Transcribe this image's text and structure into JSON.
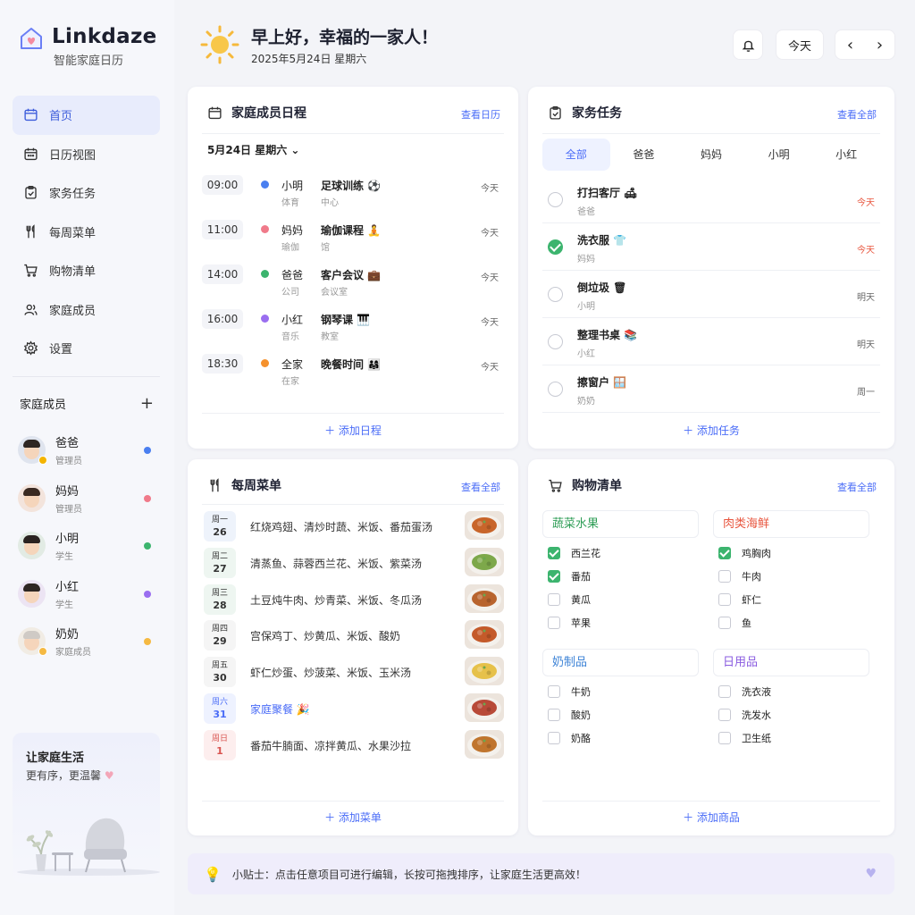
{
  "app": {
    "name": "Linkdaze",
    "subtitle": "智能家庭日历"
  },
  "nav": [
    {
      "label": "首页",
      "icon": "calendar-icon",
      "active": true
    },
    {
      "label": "日历视图",
      "icon": "calendar-grid-icon"
    },
    {
      "label": "家务任务",
      "icon": "clipboard-check-icon"
    },
    {
      "label": "每周菜单",
      "icon": "utensils-icon"
    },
    {
      "label": "购物清单",
      "icon": "cart-icon"
    },
    {
      "label": "家庭成员",
      "icon": "users-icon"
    },
    {
      "label": "设置",
      "icon": "gear-icon"
    }
  ],
  "family": {
    "title": "家庭成员",
    "add": "+",
    "members": [
      {
        "name": "爸爸",
        "role": "管理员",
        "color": "#4a7ff0"
      },
      {
        "name": "妈妈",
        "role": "管理员",
        "color": "#f07a8a"
      },
      {
        "name": "小明",
        "role": "学生",
        "color": "#3cb46e"
      },
      {
        "name": "小红",
        "role": "学生",
        "color": "#9a6ef0"
      },
      {
        "name": "奶奶",
        "role": "家庭成员",
        "color": "#f5b942"
      }
    ]
  },
  "promo": {
    "title": "让家庭生活",
    "subtitle": "更有序，更温馨",
    "heart": "♥"
  },
  "header": {
    "greeting": "早上好，幸福的一家人！",
    "date": "2025年5月24日  星期六",
    "today_button": "今天",
    "prev": "‹",
    "next": "›"
  },
  "schedule": {
    "title": "家庭成员日程",
    "link": "查看日历",
    "date_label": "5月24日  星期六 ⌄",
    "events": [
      {
        "time": "09:00",
        "person": "小明",
        "person_sub": "体育",
        "title": "足球训练 ⚽",
        "location": "中心",
        "day": "今天",
        "color": "#4a7ff0"
      },
      {
        "time": "11:00",
        "person": "妈妈",
        "person_sub": "瑜伽",
        "title": "瑜伽课程 🧘",
        "location": "馆",
        "day": "今天",
        "color": "#f07a8a"
      },
      {
        "time": "14:00",
        "person": "爸爸",
        "person_sub": "公司",
        "title": "客户会议 💼",
        "location": "会议室",
        "day": "今天",
        "color": "#3cb46e"
      },
      {
        "time": "16:00",
        "person": "小红",
        "person_sub": "音乐",
        "title": "钢琴课 🎹",
        "location": "教室",
        "day": "今天",
        "color": "#9a6ef0"
      },
      {
        "time": "18:30",
        "person": "全家",
        "person_sub": "在家",
        "title": "晚餐时间 👨‍👩‍👧",
        "location": "",
        "day": "今天",
        "color": "#f5912d"
      }
    ],
    "add": "＋  添加日程"
  },
  "chores": {
    "title": "家务任务",
    "link": "查看全部",
    "tabs": [
      "全部",
      "爸爸",
      "妈妈",
      "小明",
      "小红"
    ],
    "tasks": [
      {
        "title": "打扫客厅  🛋",
        "who": "爸爸",
        "due": "今天",
        "done": false,
        "due_red": true
      },
      {
        "title": "洗衣服  👕",
        "who": "妈妈",
        "due": "今天",
        "done": true,
        "due_red": true
      },
      {
        "title": "倒垃圾  🗑",
        "who": "小明",
        "due": "明天",
        "done": false,
        "due_red": false
      },
      {
        "title": "整理书桌  📚",
        "who": "小红",
        "due": "明天",
        "done": false,
        "due_red": false
      },
      {
        "title": "擦窗户  🪟",
        "who": "奶奶",
        "due": "周一",
        "done": false,
        "due_red": false
      }
    ],
    "add": "＋  添加任务"
  },
  "menu": {
    "title": "每周菜单",
    "link": "查看全部",
    "days": [
      {
        "weekday": "周一",
        "date": "26",
        "dishes": "红烧鸡翅、清炒时蔬、米饭、番茄蛋汤",
        "chip": "#eef3fb",
        "color": "#333"
      },
      {
        "weekday": "周二",
        "date": "27",
        "dishes": "清蒸鱼、蒜蓉西兰花、米饭、紫菜汤",
        "chip": "#eef6f1",
        "color": "#333"
      },
      {
        "weekday": "周三",
        "date": "28",
        "dishes": "土豆炖牛肉、炒青菜、米饭、冬瓜汤",
        "chip": "#eef6f1",
        "color": "#333"
      },
      {
        "weekday": "周四",
        "date": "29",
        "dishes": "宫保鸡丁、炒黄瓜、米饭、酸奶",
        "chip": "#f5f5f5",
        "color": "#333"
      },
      {
        "weekday": "周五",
        "date": "30",
        "dishes": "虾仁炒蛋、炒菠菜、米饭、玉米汤",
        "chip": "#f5f5f5",
        "color": "#333"
      },
      {
        "weekday": "周六",
        "date": "31",
        "dishes": "家庭聚餐  🎉",
        "chip": "#eef2ff",
        "color": "#4a6cf7"
      },
      {
        "weekday": "周日",
        "date": "1",
        "dishes": "番茄牛腩面、凉拌黄瓜、水果沙拉",
        "chip": "#fdeeee",
        "color": "#d9534f"
      }
    ],
    "add": "＋  添加菜单"
  },
  "shopping": {
    "title": "购物清单",
    "link": "查看全部",
    "categories": [
      {
        "name": "蔬菜水果",
        "color": "#2f9e57",
        "items": [
          {
            "name": "西兰花",
            "done": true
          },
          {
            "name": "番茄",
            "done": true
          },
          {
            "name": "黄瓜",
            "done": false
          },
          {
            "name": "苹果",
            "done": false
          }
        ]
      },
      {
        "name": "肉类海鲜",
        "color": "#e8563f",
        "items": [
          {
            "name": "鸡胸肉",
            "done": true
          },
          {
            "name": "牛肉",
            "done": false
          },
          {
            "name": "虾仁",
            "done": false
          },
          {
            "name": "鱼",
            "done": false
          }
        ]
      },
      {
        "name": "奶制品",
        "color": "#3b82d6",
        "items": [
          {
            "name": "牛奶",
            "done": false
          },
          {
            "name": "酸奶",
            "done": false
          },
          {
            "name": "奶酪",
            "done": false
          }
        ]
      },
      {
        "name": "日用品",
        "color": "#8a5ce0",
        "items": [
          {
            "name": "洗衣液",
            "done": false
          },
          {
            "name": "洗发水",
            "done": false
          },
          {
            "name": "卫生纸",
            "done": false
          }
        ]
      }
    ],
    "add": "＋  添加商品"
  },
  "tip": {
    "bulb": "💡",
    "text": "小贴士：点击任意项目可进行编辑，长按可拖拽排序，让家庭生活更高效！",
    "heart": "♥"
  }
}
